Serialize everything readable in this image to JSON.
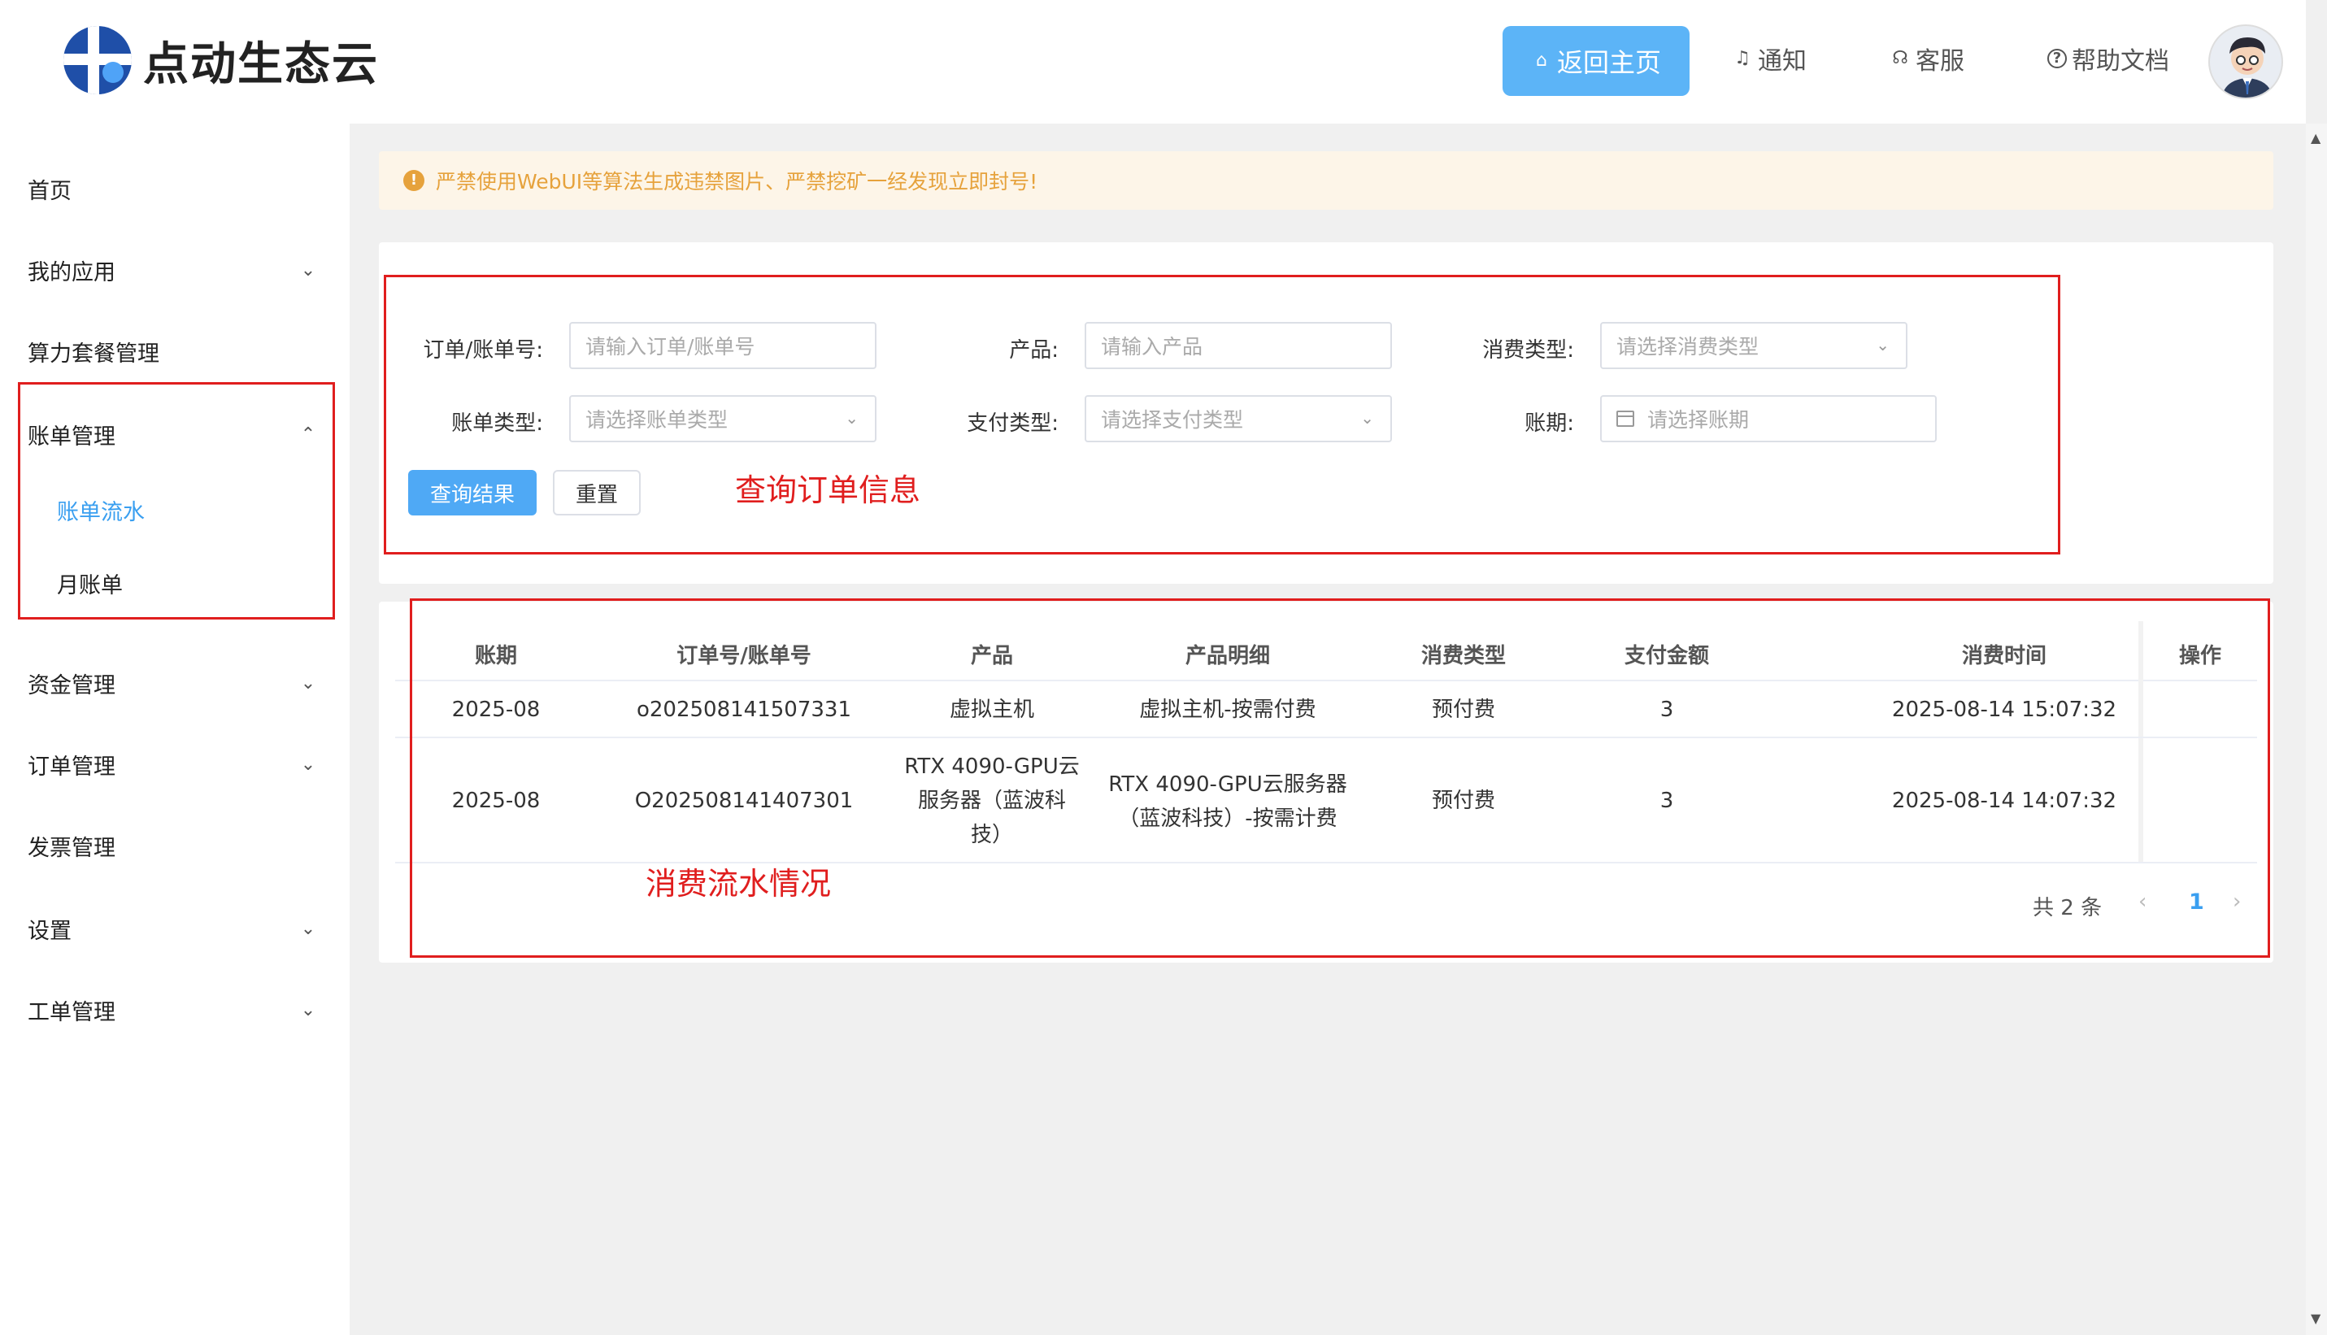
{
  "header": {
    "logo_text": "点动生态云",
    "home_button": "返回主页",
    "notify": "通知",
    "service": "客服",
    "help": "帮助文档"
  },
  "sidebar": {
    "items": [
      {
        "label": "首页"
      },
      {
        "label": "我的应用"
      },
      {
        "label": "算力套餐管理"
      },
      {
        "label": "账单管理"
      },
      {
        "label": "资金管理"
      },
      {
        "label": "订单管理"
      },
      {
        "label": "发票管理"
      },
      {
        "label": "设置"
      },
      {
        "label": "工单管理"
      }
    ],
    "sub_items": [
      {
        "label": "账单流水"
      },
      {
        "label": "月账单"
      }
    ]
  },
  "notice": "严禁使用WebUI等算法生成违禁图片、严禁挖矿一经发现立即封号!",
  "filters": {
    "order_label": "订单/账单号:",
    "order_placeholder": "请输入订单/账单号",
    "product_label": "产品:",
    "product_placeholder": "请输入产品",
    "consume_label": "消费类型:",
    "consume_placeholder": "请选择消费类型",
    "bill_type_label": "账单类型:",
    "bill_type_placeholder": "请选择账单类型",
    "pay_type_label": "支付类型:",
    "pay_type_placeholder": "请选择支付类型",
    "period_label": "账期:",
    "period_placeholder": "请选择账期",
    "query_button": "查询结果",
    "reset_button": "重置"
  },
  "annotations": {
    "query": "查询订单信息",
    "flow": "消费流水情况"
  },
  "table": {
    "headers": [
      "账期",
      "订单号/账单号",
      "产品",
      "产品明细",
      "消费类型",
      "支付金额",
      "消费时间",
      "操作"
    ],
    "rows": [
      {
        "period": "2025-08",
        "order": "o202508141507331",
        "product": "虚拟主机",
        "detail": "虚拟主机-按需付费",
        "consume": "预付费",
        "amount": "3",
        "time": "2025-08-14 15:07:32"
      },
      {
        "period": "2025-08",
        "order": "O202508141407301",
        "product_l1": "RTX 4090-GPU云",
        "product_l2": "服务器（蓝波科",
        "product_l3": "技）",
        "detail_l1": "RTX 4090-GPU云服务器",
        "detail_l2": "（蓝波科技）-按需计费",
        "consume": "预付费",
        "amount": "3",
        "time": "2025-08-14 14:07:32"
      }
    ]
  },
  "pager": {
    "total": "共 2 条",
    "current": "1"
  },
  "colors": {
    "primary": "#5cb4f7",
    "annotation": "#e01e1e",
    "warning": "#e6a23c"
  }
}
